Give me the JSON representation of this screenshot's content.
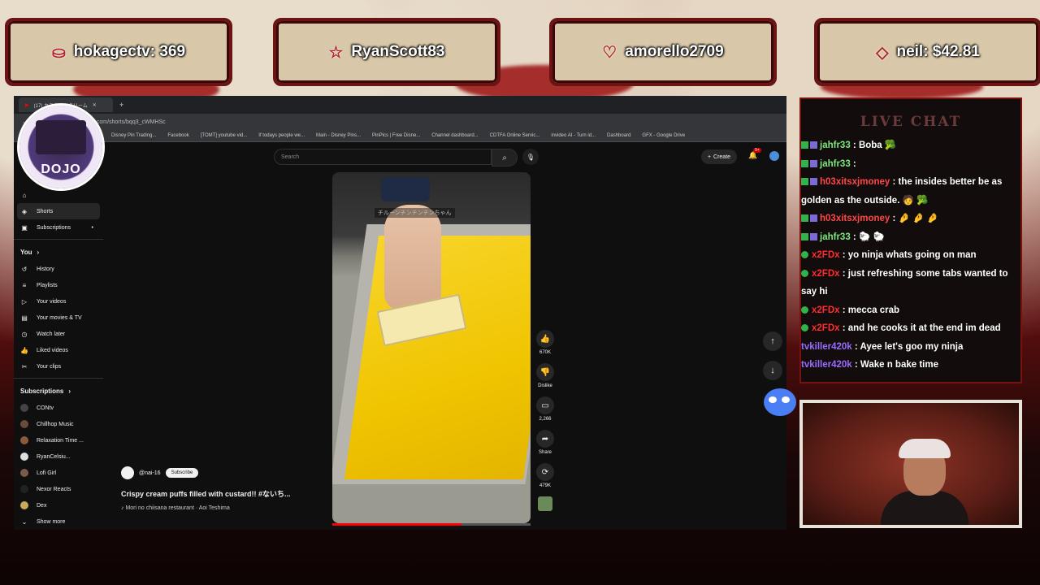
{
  "overlay": {
    "banners": [
      {
        "icon": "coins-icon",
        "text": "hokagectv: 369"
      },
      {
        "icon": "star-icon",
        "text": "RyanScott83"
      },
      {
        "icon": "heart-handshake-icon",
        "text": "amorello2709"
      },
      {
        "icon": "diamond-icon",
        "text": "neil: $42.81"
      }
    ],
    "logo_text": "DOJO"
  },
  "browser": {
    "tab_title": "(17) カスタードクリーム",
    "url": "youtube.com/shorts/bqq3_cWMHSc",
    "bookmarks": [
      "Disney Pin Trading...",
      "Facebook",
      "[TOMT] youtube vid...",
      "If todays people we...",
      "Main - Disney Pins...",
      "PinPics | Free Disne...",
      "Channel dashboard...",
      "CDTFA Online Servic...",
      "invideo AI - Turn id...",
      "Dashboard",
      "GFX - Google Drive"
    ]
  },
  "youtube": {
    "search_placeholder": "Search",
    "create_label": "Create",
    "notification_count": "9+",
    "sidebar": {
      "shorts": "Shorts",
      "subscriptions": "Subscriptions",
      "you_header": "You",
      "you_items": [
        "History",
        "Playlists",
        "Your videos",
        "Your movies & TV",
        "Watch later",
        "Liked videos",
        "Your clips"
      ],
      "subs_header": "Subscriptions",
      "subs": [
        "CONtv",
        "Chillhop Music",
        "Relaxation Time ...",
        "RyanCelsiu...",
        "Lofi Girl",
        "Nexor Reacts",
        "Dex"
      ],
      "show_more": "Show more"
    },
    "video": {
      "caption_overlay": "チルーンチンチンチンちゃん",
      "progress": 0.65,
      "channel": "@nai-16",
      "subscribe": "Subscribe",
      "title": "Crispy cream puffs filled with custard!! #ないち...",
      "music": "Mori no chiisana restaurant · Aoi Teshima",
      "likes": "670K",
      "dislike": "Dislike",
      "comments": "2,266",
      "share": "Share",
      "remix": "479K"
    }
  },
  "chat": {
    "title": "LIVE CHAT",
    "messages": [
      {
        "user": "jahfr33",
        "color": "#7be87b",
        "text": " : Boba 🥦",
        "badge": "sub"
      },
      {
        "user": "jahfr33",
        "color": "#7be87b",
        "text": " :",
        "badge": "sub"
      },
      {
        "user": "h03xitsxjmoney",
        "color": "#ff4747",
        "text": " : the insides better be as golden as the outside. 🧑 🥦",
        "badge": "sub"
      },
      {
        "user": "h03xitsxjmoney",
        "color": "#ff4747",
        "text": " : 🤌 🤌 🤌",
        "badge": "sub"
      },
      {
        "user": "jahfr33",
        "color": "#7be87b",
        "text": " : 🐑 🐑",
        "badge": "sub"
      },
      {
        "user": "x2FDx",
        "color": "#ff2d2d",
        "text": " : yo ninja whats going on man",
        "badge": "dot"
      },
      {
        "user": "x2FDx",
        "color": "#ff2d2d",
        "text": " : just refreshing some tabs wanted to say hi",
        "badge": "dot"
      },
      {
        "user": "x2FDx",
        "color": "#ff2d2d",
        "text": " : mecca crab",
        "badge": "dot"
      },
      {
        "user": "x2FDx",
        "color": "#ff2d2d",
        "text": " : and he cooks it at the end im dead",
        "badge": "dot"
      },
      {
        "user": "tvkiller420k",
        "color": "#9a6cff",
        "text": " : Ayee let's goo my ninja",
        "badge": "none"
      },
      {
        "user": "tvkiller420k",
        "color": "#9a6cff",
        "text": " : Wake n bake time",
        "badge": "none"
      }
    ]
  }
}
